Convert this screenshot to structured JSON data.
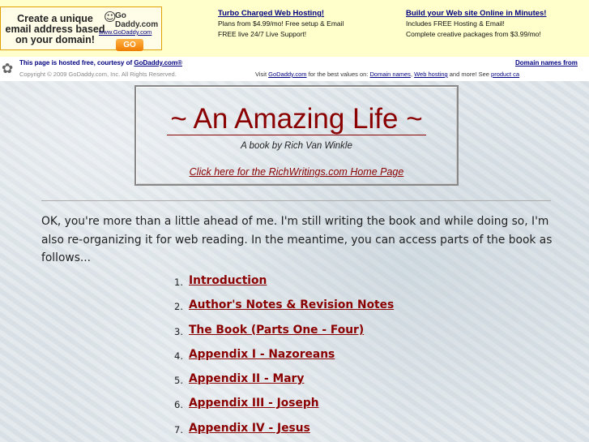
{
  "ad_banner": {
    "box_text": "Create a unique email address based on your domain!",
    "logo_text": "Go Daddy.com",
    "logo_url": "www.GoDaddy.com",
    "go_label": "GO",
    "col1": {
      "heading": "Turbo Charged Web Hosting!",
      "line1": "Plans from $4.99/mo! Free setup & Email",
      "line2": "FREE live 24/7 Live Support!"
    },
    "col2": {
      "heading": "Build your Web site Online in Minutes!",
      "line1": "Includes FREE Hosting & Email!",
      "line2": "Complete creative packages from $3.99/mo!"
    }
  },
  "host_bar": {
    "hosted_prefix": "This page is hosted free, courtesy of ",
    "hosted_link": "GoDaddy.com®",
    "copyright": "Copyright © 2009 GoDaddy.com, Inc. All Rights Reserved.",
    "right_link": "Domain names from",
    "visit_prefix": "Visit ",
    "visit_link": "GoDaddy.com",
    "visit_mid": " for the best values on: ",
    "link_domains": "Domain names",
    "sep": ", ",
    "link_hosting": "Web hosting",
    "visit_suffix": " and more! See ",
    "link_product": "product ca"
  },
  "title_box": {
    "heading": "~ An Amazing Life ~",
    "subtitle": "A book by Rich Van Winkle",
    "home_link": "Click here for the RichWritings.com Home Page"
  },
  "intro_text": "OK, you're more than a little ahead of me. I'm still writing the book and while doing so, I'm also re-organizing it for web reading. In the meantime, you can access parts of the book as follows...",
  "toc": [
    {
      "num": "1.",
      "label": "Introduction"
    },
    {
      "num": "2.",
      "label": "Author's Notes & Revision Notes"
    },
    {
      "num": "3.",
      "label": "The Book (Parts One - Four)"
    },
    {
      "num": "4.",
      "label": "Appendix I - Nazoreans"
    },
    {
      "num": "5.",
      "label": "Appendix II - Mary"
    },
    {
      "num": "6.",
      "label": "Appendix III - Joseph"
    },
    {
      "num": "7.",
      "label": "Appendix IV - Jesus"
    }
  ],
  "colors": {
    "link_red": "#8b0000",
    "ad_bg": "#ffffcc",
    "ad_link": "#000080"
  },
  "icons": {
    "mascot": "godaddy-mascot-icon"
  }
}
